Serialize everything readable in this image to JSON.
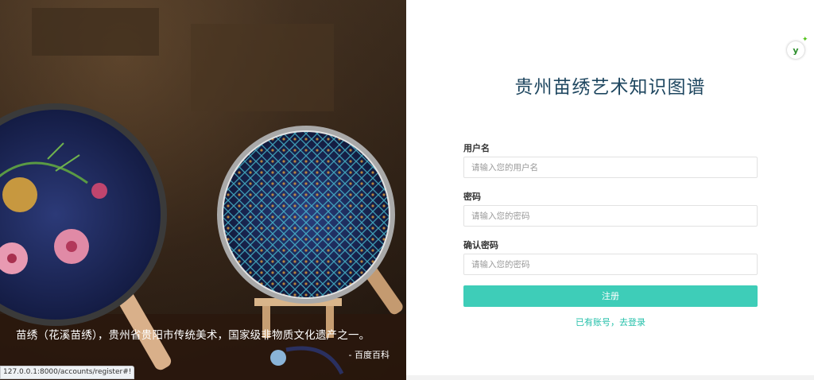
{
  "hero": {
    "caption": "苗绣（花溪苗绣），贵州省贵阳市传统美术，国家级非物质文化遗产之一。",
    "source": "- 百度百科"
  },
  "app": {
    "title": "贵州苗绣艺术知识图谱"
  },
  "form": {
    "username": {
      "label": "用户名",
      "placeholder": "请输入您的用户名",
      "value": ""
    },
    "password": {
      "label": "密码",
      "placeholder": "请输入您的密码",
      "value": ""
    },
    "confirm": {
      "label": "确认密码",
      "placeholder": "请输入您的密码",
      "value": ""
    },
    "submit_label": "注册",
    "login_link": "已有账号，去登录"
  },
  "status_url": "127.0.0.1:8000/accounts/register#!",
  "colors": {
    "accent": "#3ecdb8",
    "link": "#25c0aa",
    "title": "#1f4760"
  },
  "icons": {
    "extension": "y-extension-icon"
  }
}
